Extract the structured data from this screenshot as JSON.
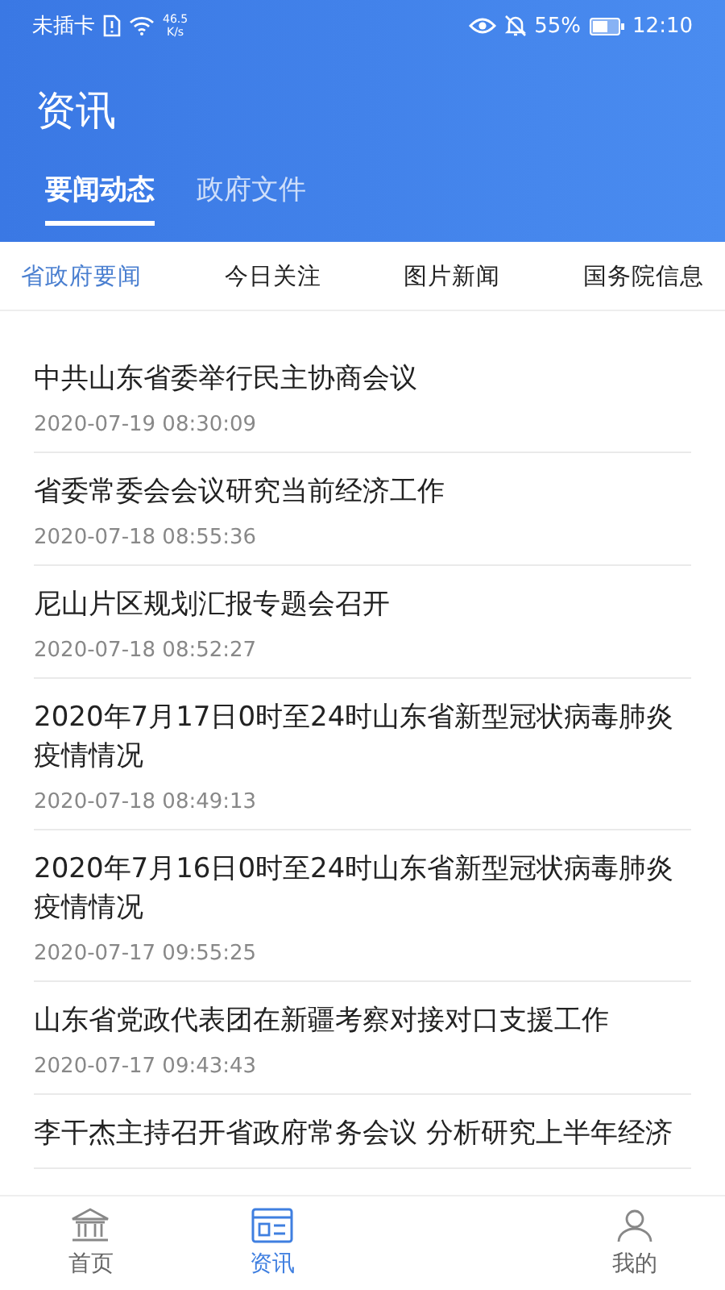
{
  "status_bar": {
    "carrier": "未插卡",
    "speed": "46.5",
    "speed_unit": "K/s",
    "battery": "55%",
    "time": "12:10"
  },
  "header": {
    "title": "资讯"
  },
  "tabs": [
    {
      "label": "要闻动态",
      "selected": true
    },
    {
      "label": "政府文件",
      "selected": false
    }
  ],
  "categories": [
    {
      "label": "省政府要闻",
      "selected": true
    },
    {
      "label": "今日关注",
      "selected": false
    },
    {
      "label": "图片新闻",
      "selected": false
    },
    {
      "label": "国务院信息",
      "selected": false
    }
  ],
  "news": [
    {
      "title": "中共山东省委举行民主协商会议",
      "date": "2020-07-19 08:30:09"
    },
    {
      "title": "省委常委会会议研究当前经济工作",
      "date": "2020-07-18 08:55:36"
    },
    {
      "title": "尼山片区规划汇报专题会召开",
      "date": "2020-07-18 08:52:27"
    },
    {
      "title": "2020年7月17日0时至24时山东省新型冠状病毒肺炎疫情情况",
      "date": "2020-07-18 08:49:13"
    },
    {
      "title": "2020年7月16日0时至24时山东省新型冠状病毒肺炎疫情情况",
      "date": "2020-07-17 09:55:25"
    },
    {
      "title": "山东省党政代表团在新疆考察对接对口支援工作",
      "date": "2020-07-17 09:43:43"
    },
    {
      "title": "李干杰主持召开省政府常务会议 分析研究上半年经济"
    }
  ],
  "bottom_nav": [
    {
      "label": "首页",
      "kind": "home",
      "selected": false
    },
    {
      "label": "资讯",
      "kind": "news",
      "selected": true
    },
    {
      "label": "我的",
      "kind": "profile",
      "selected": false
    }
  ]
}
